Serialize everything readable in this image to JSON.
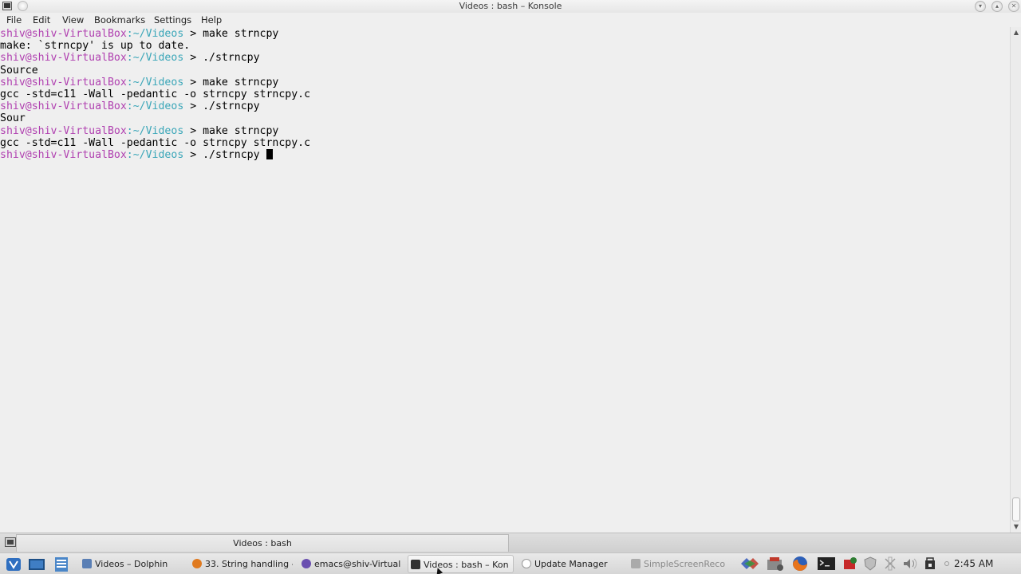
{
  "window": {
    "title": "Videos : bash – Konsole"
  },
  "menu": [
    "File",
    "Edit",
    "View",
    "Bookmarks",
    "Settings",
    "Help"
  ],
  "prompt": {
    "user": "shiv@shiv-VirtualBox",
    "path": ":~/Videos",
    "symbol": " > "
  },
  "terminal_lines": [
    {
      "type": "prompt",
      "cmd": "make strncpy"
    },
    {
      "type": "output",
      "text": "make: `strncpy' is up to date."
    },
    {
      "type": "prompt",
      "cmd": "./strncpy"
    },
    {
      "type": "output",
      "text": "Source"
    },
    {
      "type": "prompt",
      "cmd": "make strncpy"
    },
    {
      "type": "output",
      "text": "gcc -std=c11 -Wall -pedantic -o strncpy strncpy.c"
    },
    {
      "type": "prompt",
      "cmd": "./strncpy"
    },
    {
      "type": "output",
      "text": "Sour"
    },
    {
      "type": "prompt",
      "cmd": "make strncpy"
    },
    {
      "type": "output",
      "text": "gcc -std=c11 -Wall -pedantic -o strncpy strncpy.c"
    },
    {
      "type": "prompt",
      "cmd": "./strncpy ",
      "cursor": true
    }
  ],
  "tabbar": {
    "tab_label": "Videos : bash"
  },
  "taskbar": {
    "tasks": [
      {
        "label": "Videos – Dolphin",
        "icon": "dolphin-icon",
        "color": "#5a7fb5"
      },
      {
        "label": "33. String handling -",
        "icon": "firefox-icon",
        "color": "#e07a1f"
      },
      {
        "label": "emacs@shiv-Virtual",
        "icon": "emacs-icon",
        "color": "#6a4fb0"
      },
      {
        "label": "Videos : bash – Kon",
        "icon": "konsole-icon",
        "color": "#333333",
        "active": true
      },
      {
        "label": "Update Manager",
        "icon": "shield-icon",
        "color": "#999999"
      },
      {
        "label": "SimpleScreenReco",
        "icon": "recorder-icon",
        "color": "#888888",
        "dim": true
      }
    ],
    "clock": "2:45 AM"
  },
  "colors": {
    "prompt_user": "#b040b0",
    "prompt_path": "#3aa6b8",
    "background": "#efefef"
  }
}
